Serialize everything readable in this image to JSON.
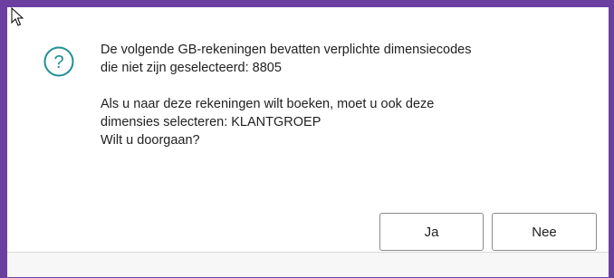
{
  "dialog": {
    "icon": "question-icon",
    "message_line_1": "De volgende GB-rekeningen bevatten verplichte dimensiecodes",
    "message_line_2": "die niet zijn geselecteerd: 8805",
    "message_line_3": "Als u naar deze rekeningen wilt boeken, moet u ook deze",
    "message_line_4": "dimensies selecteren: KLANTGROEP",
    "message_line_5": "Wilt u doorgaan?",
    "yes_label": "Ja",
    "no_label": "Nee"
  },
  "colors": {
    "frame_border": "#6b3fa0",
    "icon_teal": "#1f8f94",
    "text": "#212121",
    "button_border": "#8a8a8a"
  }
}
